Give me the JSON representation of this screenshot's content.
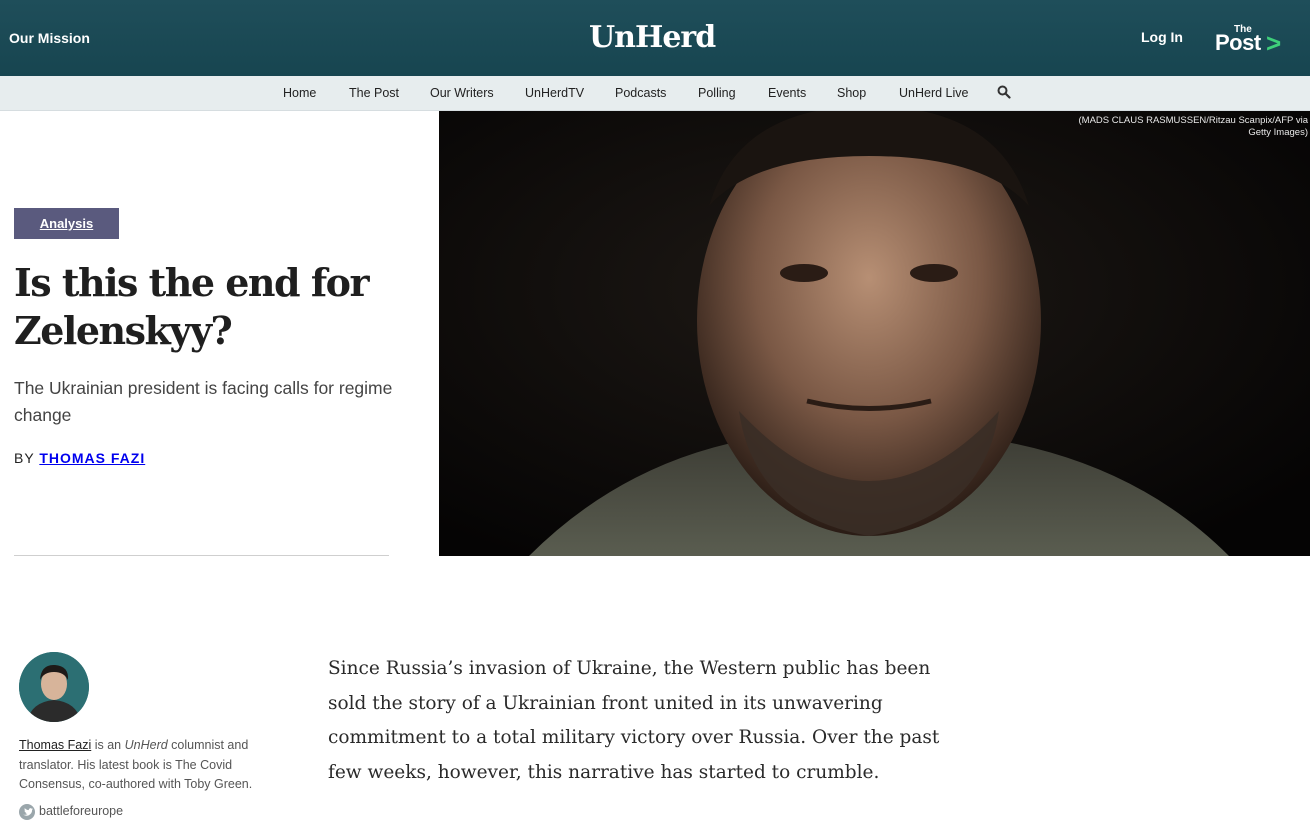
{
  "header": {
    "mission_label": "Our Mission",
    "logo_text": "UnHerd",
    "login_label": "Log In",
    "post_logo_small": "The",
    "post_logo_large": "Post",
    "post_logo_arrow": ">"
  },
  "nav": {
    "items": [
      {
        "label": "Home"
      },
      {
        "label": "The Post"
      },
      {
        "label": "Our Writers"
      },
      {
        "label": "UnHerdTV"
      },
      {
        "label": "Podcasts"
      },
      {
        "label": "Polling"
      },
      {
        "label": "Events"
      },
      {
        "label": "Shop"
      },
      {
        "label": "UnHerd Live"
      }
    ],
    "search_icon": "search-icon"
  },
  "article": {
    "category": "Analysis",
    "headline_line1": "Is this the end for",
    "headline_line2": "Zelenskyy?",
    "dek": "The Ukrainian president is facing calls for regime change",
    "byline_prefix": "BY",
    "byline_author": "THOMAS FAZI",
    "image_credit": "(MADS CLAUS RASMUSSEN/Ritzau Scanpix/AFP via Getty Images)",
    "body": "Since Russia’s invasion of Ukraine, the Western public has been sold the story of a Ukrainian front united in its unwavering commitment to a total military victory over Russia. Over the past few weeks, however, this narrative has started to crumble."
  },
  "author_card": {
    "name": "Thomas Fazi",
    "bio_part1": " is an ",
    "bio_brand": "UnHerd",
    "bio_part2": " columnist and translator. His latest book is The Covid Consensus, co-authored with Toby Green.",
    "twitter_handle": "battleforeurope"
  },
  "colors": {
    "header_bg": "#1f4e5a",
    "nav_bg": "#e7edee",
    "badge_bg": "#5a5a7e",
    "post_arrow": "#3ecf7a"
  }
}
